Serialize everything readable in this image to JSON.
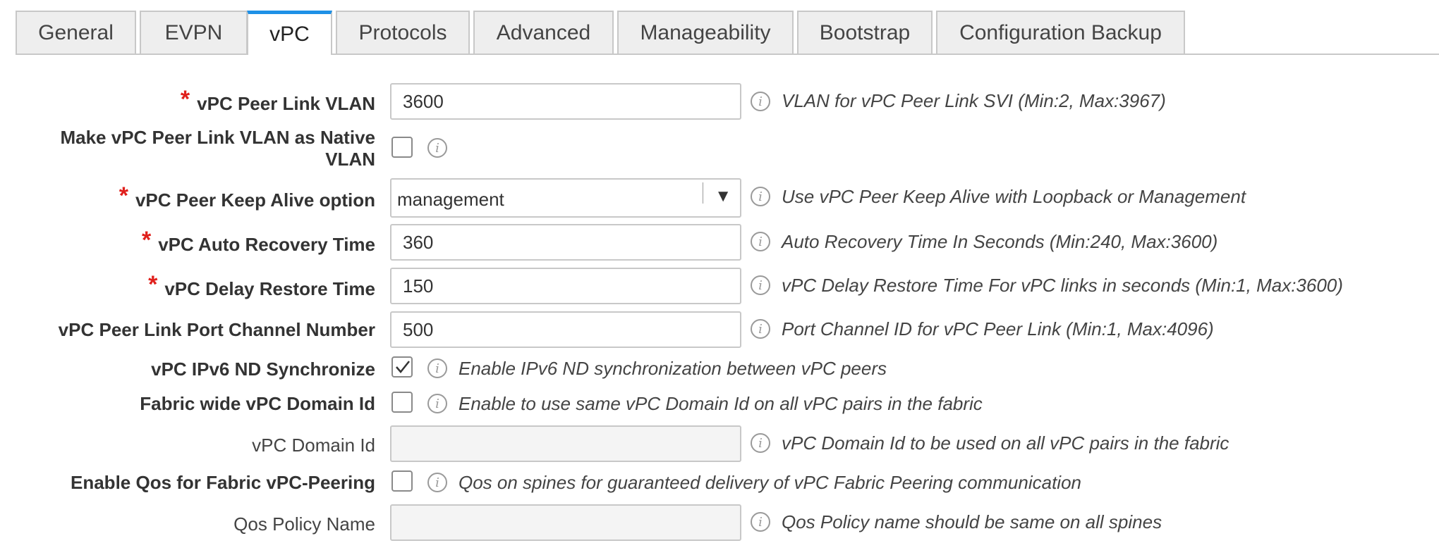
{
  "tabs": [
    {
      "label": "General"
    },
    {
      "label": "EVPN"
    },
    {
      "label": "vPC"
    },
    {
      "label": "Protocols"
    },
    {
      "label": "Advanced"
    },
    {
      "label": "Manageability"
    },
    {
      "label": "Bootstrap"
    },
    {
      "label": "Configuration Backup"
    }
  ],
  "active_tab": "vPC",
  "required_marker": "*",
  "info_glyph": "i",
  "icons": {
    "info": "info-circle-icon",
    "dropdown": "triangle-down-icon",
    "check": "checkmark-icon"
  },
  "colors": {
    "accent": "#1e90e6",
    "required": "#e0201c"
  },
  "form": {
    "peer_link_vlan": {
      "label": "vPC Peer Link VLAN",
      "value": "3600",
      "help": "VLAN for vPC Peer Link SVI (Min:2, Max:3967)",
      "required": true
    },
    "native_vlan": {
      "label_line1": "Make vPC Peer Link VLAN as Native",
      "label_line2": "VLAN",
      "checked": false
    },
    "keep_alive": {
      "label": "vPC Peer Keep Alive option",
      "value": "management",
      "help": "Use vPC Peer Keep Alive with Loopback or Management",
      "required": true
    },
    "auto_recovery": {
      "label": "vPC Auto Recovery Time",
      "value": "360",
      "help": "Auto Recovery Time In Seconds (Min:240, Max:3600)",
      "required": true
    },
    "delay_restore": {
      "label": "vPC Delay Restore Time",
      "value": "150",
      "help": "vPC Delay Restore Time For vPC links in seconds (Min:1, Max:3600)",
      "required": true
    },
    "port_channel": {
      "label": "vPC Peer Link Port Channel Number",
      "value": "500",
      "help": "Port Channel ID for vPC Peer Link (Min:1, Max:4096)"
    },
    "ipv6_nd": {
      "label": "vPC IPv6 ND Synchronize",
      "checked": true,
      "help": "Enable IPv6 ND synchronization between vPC peers"
    },
    "fabric_domain": {
      "label": "Fabric wide vPC Domain Id",
      "checked": false,
      "help": "Enable to use same vPC Domain Id on all vPC pairs in the fabric"
    },
    "domain_id": {
      "label": "vPC Domain Id",
      "value": "",
      "help": "vPC Domain Id to be used on all vPC pairs in the fabric",
      "disabled": true
    },
    "qos_enable": {
      "label": "Enable Qos for Fabric vPC-Peering",
      "checked": false,
      "help": "Qos on spines for guaranteed delivery of vPC Fabric Peering communication"
    },
    "qos_policy": {
      "label": "Qos Policy Name",
      "value": "",
      "help": "Qos Policy name should be same on all spines",
      "disabled": true
    }
  }
}
